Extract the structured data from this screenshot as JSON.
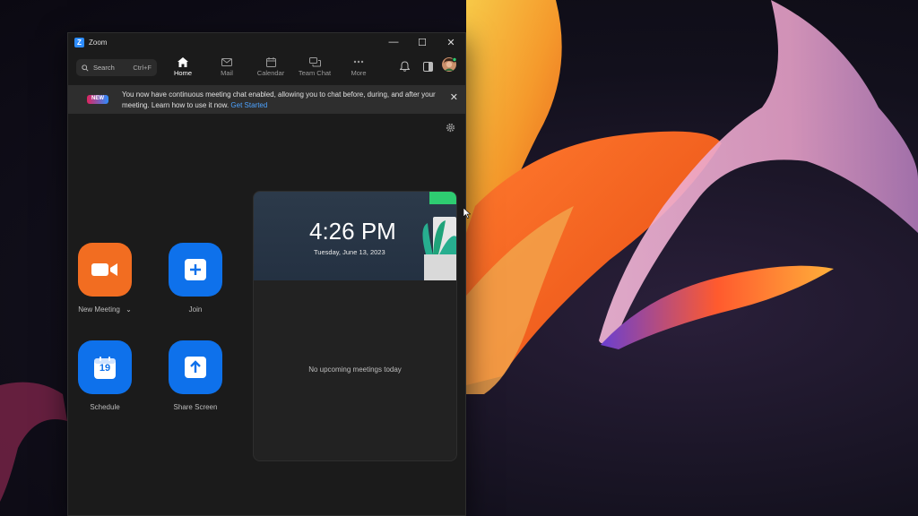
{
  "window": {
    "title": "Zoom",
    "logo_letter": "Z",
    "controls": {
      "minimize": "—",
      "maximize": "☐",
      "close": "✕"
    }
  },
  "toolbar": {
    "search_label": "Search",
    "search_shortcut": "Ctrl+F",
    "tabs": [
      {
        "label": "Home",
        "icon": "home-icon",
        "active": true
      },
      {
        "label": "Mail",
        "icon": "mail-icon",
        "active": false
      },
      {
        "label": "Calendar",
        "icon": "calendar-icon",
        "active": false
      },
      {
        "label": "Team Chat",
        "icon": "chat-icon",
        "active": false
      },
      {
        "label": "More",
        "icon": "more-icon",
        "active": false
      }
    ]
  },
  "banner": {
    "badge": "NEW",
    "text": "You now have continuous meeting chat enabled, allowing you to chat before, during, and after your meeting. Learn how to use it now.",
    "link": "Get Started",
    "close": "✕"
  },
  "actions": {
    "new_meeting": {
      "label": "New Meeting",
      "dropdown": "⌄"
    },
    "join": {
      "label": "Join"
    },
    "schedule": {
      "label": "Schedule",
      "calendar_day": "19"
    },
    "share_screen": {
      "label": "Share Screen"
    }
  },
  "meetings": {
    "time": "4:26 PM",
    "date": "Tuesday, June 13, 2023",
    "empty_text": "No upcoming meetings today"
  },
  "colors": {
    "accent": "#0e71eb",
    "new_meeting": "#f26d21",
    "link": "#4da3ff",
    "window_bg": "#1b1b1b"
  }
}
